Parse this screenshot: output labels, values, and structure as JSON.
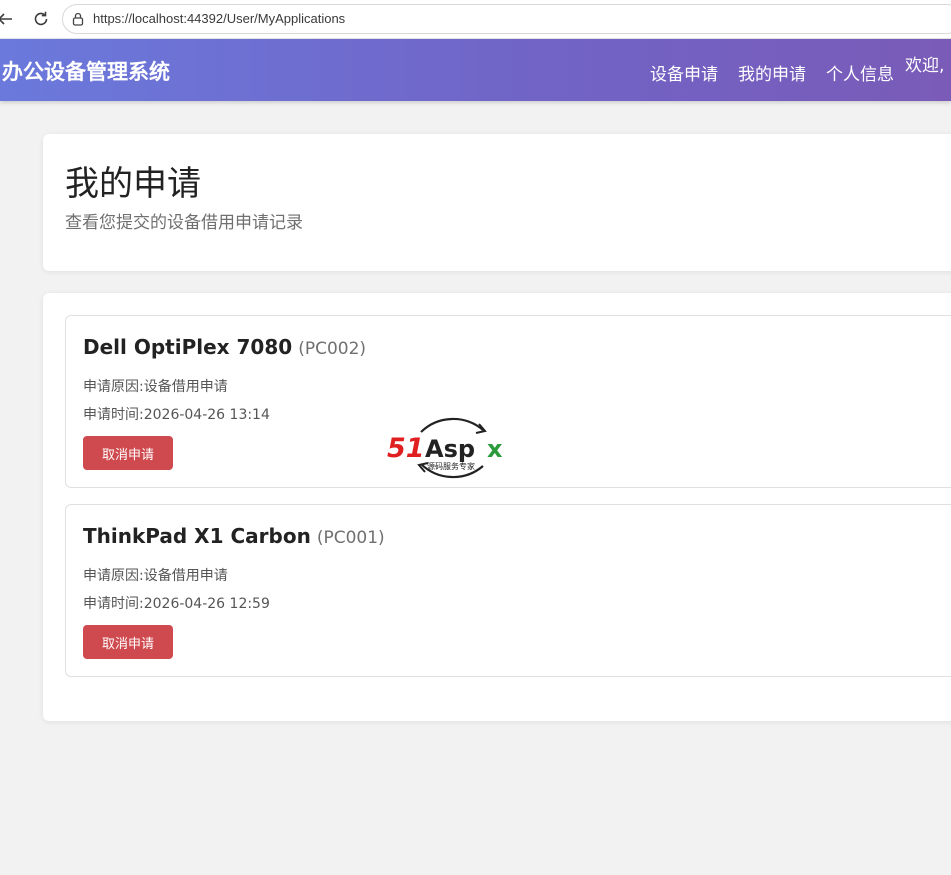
{
  "browser": {
    "url": "https://localhost:44392/User/MyApplications",
    "back_icon": "arrow-left-icon",
    "reload_icon": "reload-icon",
    "lock_icon": "lock-icon"
  },
  "header": {
    "brand": "办公设备管理系统",
    "nav": [
      "设备申请",
      "我的申请",
      "个人信息"
    ],
    "welcome": "欢迎,"
  },
  "page": {
    "title": "我的申请",
    "subtitle": "查看您提交的设备借用申请记录"
  },
  "applications": [
    {
      "name": "Dell OptiPlex 7080",
      "code": "(PC002)",
      "reason_label": "申请原因:",
      "reason": "设备借用申请",
      "time_label": "申请时间:",
      "time": "2026-04-26 13:14",
      "cancel_label": "取消申请"
    },
    {
      "name": "ThinkPad X1 Carbon",
      "code": "(PC001)",
      "reason_label": "申请原因:",
      "reason": "设备借用申请",
      "time_label": "申请时间:",
      "time": "2026-04-26 12:59",
      "cancel_label": "取消申请"
    }
  ],
  "watermark": {
    "logo_text": "51Aspx",
    "tagline": "源码服务专家"
  },
  "colors": {
    "header_start": "#6b79dc",
    "header_end": "#7a5bb8",
    "danger": "#cf4a4f",
    "background": "#f2f2f2"
  }
}
